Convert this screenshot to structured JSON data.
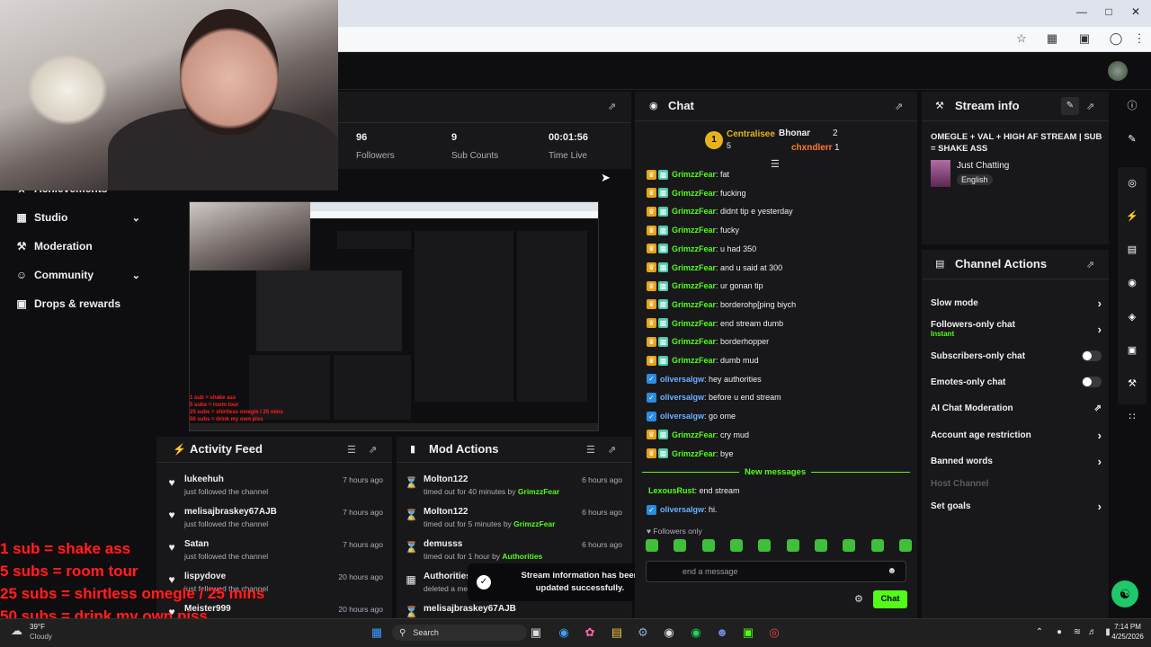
{
  "stats": {
    "followers_value": "96",
    "followers_label": "Followers",
    "subs_value": "9",
    "subs_label": "Sub Counts",
    "time_value": "00:01:56",
    "time_label": "Time Live"
  },
  "nav": [
    {
      "label": "Achievements",
      "icon": "trophy-icon"
    },
    {
      "label": "Studio",
      "icon": "studio-icon",
      "chevron": true
    },
    {
      "label": "Moderation",
      "icon": "wrench-icon"
    },
    {
      "label": "Community",
      "icon": "people-icon",
      "chevron": true
    },
    {
      "label": "Drops & rewards",
      "icon": "gift-icon"
    }
  ],
  "overlay_lines": [
    "1 sub = shake ass",
    "5 subs = room tour",
    "25 subs = shirtless omegle / 25 mins",
    "50 subs = drink my own piss"
  ],
  "activity_feed": {
    "title": "Activity Feed",
    "rows": [
      {
        "name": "lukeehuh",
        "sub": "just followed the channel",
        "time": "7 hours ago"
      },
      {
        "name": "melisajbraskey67AJB",
        "sub": "just followed the channel",
        "time": "7 hours ago"
      },
      {
        "name": "Satan",
        "sub": "just followed the channel",
        "time": "7 hours ago"
      },
      {
        "name": "lispydove",
        "sub": "just followed the channel",
        "time": "20 hours ago"
      },
      {
        "name": "Meister999",
        "sub": "",
        "time": "20 hours ago"
      }
    ]
  },
  "mod_actions": {
    "title": "Mod Actions",
    "rows": [
      {
        "name": "Molton122",
        "pre": "timed out for 40 minutes by",
        "by": "GrimzzFear",
        "time": "6 hours ago",
        "icon": "hourglass-icon"
      },
      {
        "name": "Molton122",
        "pre": "timed out for 5 minutes by",
        "by": "GrimzzFear",
        "time": "6 hours ago",
        "icon": "hourglass-icon"
      },
      {
        "name": "demusss",
        "pre": "timed out for 1 hour by",
        "by": "Authorities",
        "time": "6 hours ago",
        "icon": "hourglass-icon"
      },
      {
        "name": "Authorities",
        "pre": "deleted a me",
        "by": "",
        "time": "",
        "icon": "trash-icon"
      },
      {
        "name": "melisajbraskey67AJB",
        "pre": "",
        "by": "",
        "time": "",
        "icon": "hourglass-icon"
      }
    ]
  },
  "toast": {
    "text": "Stream information has been updated successfully."
  },
  "chat": {
    "title": "Chat",
    "leaderboard": {
      "rank1_name": "Centralisee",
      "rank1_count": "5",
      "user2_name": "Bhonar",
      "user2_count": "2",
      "user3_name": "chxndlerr",
      "user3_count": "1"
    },
    "messages": [
      {
        "user": "GrimzzFear",
        "text": "fat",
        "style": "green"
      },
      {
        "user": "GrimzzFear",
        "text": "fucking",
        "style": "green"
      },
      {
        "user": "GrimzzFear",
        "text": "didnt tip e yesterday",
        "style": "green"
      },
      {
        "user": "GrimzzFear",
        "text": "fucky",
        "style": "green"
      },
      {
        "user": "GrimzzFear",
        "text": "u had 350",
        "style": "green"
      },
      {
        "user": "GrimzzFear",
        "text": "and u said at 300",
        "style": "green"
      },
      {
        "user": "GrimzzFear",
        "text": "ur gonan tip",
        "style": "green"
      },
      {
        "user": "GrimzzFear",
        "text": "borderohp[ping biych",
        "style": "green"
      },
      {
        "user": "GrimzzFear",
        "text": "end stream dumb",
        "style": "green"
      },
      {
        "user": "GrimzzFear",
        "text": "borderhopper",
        "style": "green"
      },
      {
        "user": "GrimzzFear",
        "text": "dumb mud",
        "style": "green"
      },
      {
        "user": "oliversalgw",
        "text": "hey authorities",
        "style": "blue"
      },
      {
        "user": "oliversalgw",
        "text": "before u end stream",
        "style": "blue"
      },
      {
        "user": "oliversalgw",
        "text": "go ome",
        "style": "blue"
      },
      {
        "user": "GrimzzFear",
        "text": "cry mud",
        "style": "green"
      },
      {
        "user": "GrimzzFear",
        "text": "bye",
        "style": "green"
      }
    ],
    "new_messages_label": "New messages",
    "new": [
      {
        "user": "LexousRust",
        "text": "end stream",
        "style": "green"
      },
      {
        "user": "oliversalgw",
        "text": "hi.",
        "style": "blue"
      }
    ],
    "followers_only": "Followers only",
    "input_placeholder": "end a message",
    "send_label": "Chat"
  },
  "stream_info": {
    "title": "Stream info",
    "stream_title": "OMEGLE + VAL + HIGH AF STREAM | SUB = SHAKE ASS",
    "category": "Just Chatting",
    "language": "English"
  },
  "channel_actions": {
    "title": "Channel Actions",
    "items": [
      {
        "label": "Slow mode",
        "control": "chevron"
      },
      {
        "label": "Followers-only chat",
        "sub": "Instant",
        "control": "chevron"
      },
      {
        "label": "Subscribers-only chat",
        "control": "toggle"
      },
      {
        "label": "Emotes-only chat",
        "control": "toggle"
      },
      {
        "label": "AI Chat Moderation",
        "control": "external"
      },
      {
        "label": "Account age restriction",
        "control": "chevron"
      },
      {
        "label": "Banned words",
        "control": "chevron"
      },
      {
        "label": "Host Channel",
        "control": "none",
        "disabled": true
      },
      {
        "label": "Set goals",
        "control": "chevron"
      }
    ]
  },
  "taskbar": {
    "weather_temp": "39°F",
    "weather_desc": "Cloudy",
    "search_label": "Search",
    "time": "7:14 PM",
    "date": "4/25/2026"
  },
  "colors": {
    "accent": "#53fc18",
    "panel": "#18181b",
    "background": "#0e0e10"
  }
}
